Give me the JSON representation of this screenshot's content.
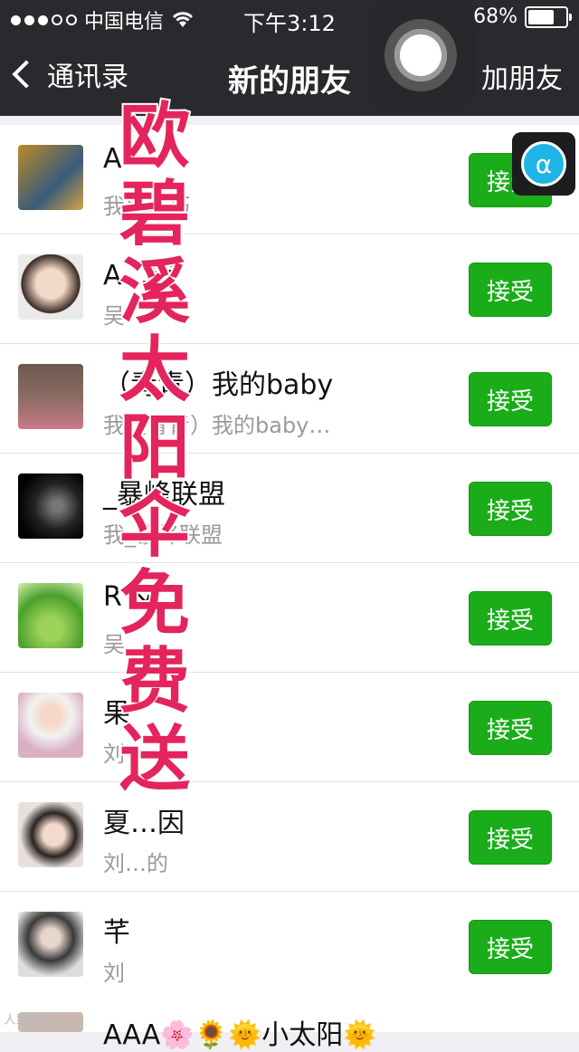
{
  "status": {
    "carrier": "中国电信",
    "time": "下午3:12",
    "battery": "68%",
    "battery_level": 0.68
  },
  "nav": {
    "back_label": "通讯录",
    "title": "新的朋友",
    "right_label": "加朋友"
  },
  "overlay_text": [
    "欧",
    "碧",
    "溪",
    "太",
    "阳",
    "伞",
    "免",
    "费",
    "送"
  ],
  "requests": [
    {
      "name": "A",
      "message": "我是…巧",
      "action": "接受"
    },
    {
      "name": "A…璇",
      "message": "吴",
      "action": "接受"
    },
    {
      "name": "（青青）我的baby",
      "message": "我（青青）我的baby…",
      "action": "接受"
    },
    {
      "name": "_暴峰联盟",
      "message": "我_暴峰联盟",
      "action": "接受"
    },
    {
      "name": "R &",
      "message": "吴",
      "action": "接受"
    },
    {
      "name": "果",
      "message": "刘",
      "action": "接受"
    },
    {
      "name": "夏…因",
      "message": "刘…的",
      "action": "接受"
    },
    {
      "name": "芊",
      "message": "刘",
      "action": "接受"
    }
  ],
  "partial_row": {
    "name": "AAA🌸🌻🌞小太阳🌞"
  },
  "watermark": "人致致信",
  "colors": {
    "accept": "#1aad19",
    "nav": "#2a2a2e",
    "overlay": "#e4245c"
  }
}
